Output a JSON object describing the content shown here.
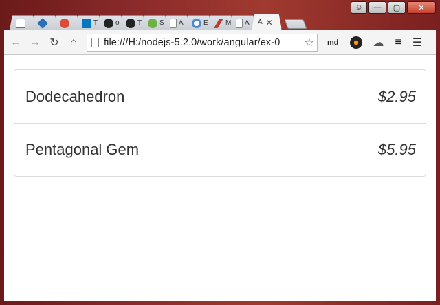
{
  "window": {
    "controls": [
      "user-icon",
      "minimize-icon",
      "maximize-icon",
      "close-icon"
    ]
  },
  "tabs": [
    {
      "title": "",
      "icon": "gmail-icon",
      "color": "#d44638"
    },
    {
      "title": "",
      "icon": "drive-icon",
      "color": "#2f6fb5"
    },
    {
      "title": "",
      "icon": "google-plus-icon",
      "color": "#dd4b39"
    },
    {
      "title": "T",
      "icon": "trello-icon",
      "color": "#0079bf"
    },
    {
      "title": "o",
      "icon": "github-icon",
      "color": "#222222"
    },
    {
      "title": "T",
      "icon": "github-icon",
      "color": "#222222"
    },
    {
      "title": "S",
      "icon": "spring-icon",
      "color": "#6db33f"
    },
    {
      "title": "A",
      "icon": "page-icon",
      "color": "#9e9e9e"
    },
    {
      "title": "E",
      "icon": "circle-icon",
      "color": "#4a8ad4"
    },
    {
      "title": "M",
      "icon": "feather-icon",
      "color": "#c0392b"
    },
    {
      "title": "A",
      "icon": "page-icon",
      "color": "#9e9e9e"
    },
    {
      "title": "A",
      "icon": "none",
      "color": "#ffffff",
      "active": true
    }
  ],
  "toolbar": {
    "url": "file:///H:/nodejs-5.2.0/work/angular/ex-0",
    "extensions": [
      "md"
    ]
  },
  "products": [
    {
      "name": "Dodecahedron",
      "price": "$2.95"
    },
    {
      "name": "Pentagonal Gem",
      "price": "$5.95"
    }
  ]
}
